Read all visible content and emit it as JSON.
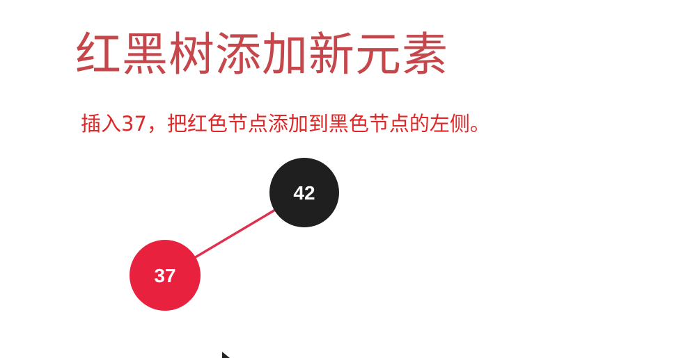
{
  "slide": {
    "title": "红黑树添加新元素",
    "subtitle": "插入37，把红色节点添加到黑色节点的左侧。"
  },
  "tree": {
    "edge_color": "#e0304e",
    "nodes": [
      {
        "id": "n42",
        "label": "42",
        "color": "#1f1f1f",
        "role": "root"
      },
      {
        "id": "n37",
        "label": "37",
        "color": "#e8213f",
        "role": "left-child"
      }
    ],
    "edges": [
      {
        "from": "n42",
        "to": "n37"
      }
    ]
  },
  "colors": {
    "title": "#c5474b",
    "subtitle": "#e02727",
    "background": "#ffffff"
  }
}
